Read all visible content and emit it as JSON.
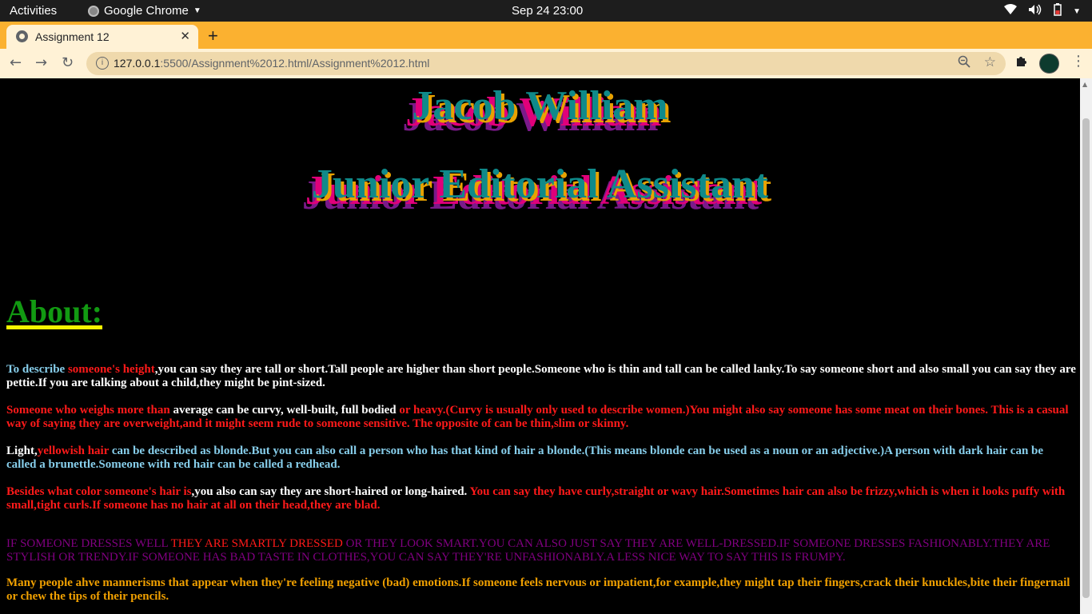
{
  "system_bar": {
    "activities": "Activities",
    "app_name": "Google Chrome",
    "clock": "Sep 24  23:00"
  },
  "browser": {
    "tab_title": "Assignment 12",
    "new_tab": "+",
    "url_host": "127.0.0.1",
    "url_rest": ":5500/Assignment%2012.html/Assignment%2012.html"
  },
  "page": {
    "name": "Jacob William",
    "role": "Junior Editorial Assistant",
    "about_heading": "About:",
    "p1": {
      "a": "To describe ",
      "b": "someone's height",
      "c": ",you can say they are tall or short.Tall people are higher than short people.Someone who is thin and tall can be called lanky.To say someone short and also small you can say they are pettie.If you are talking about a child,they might be pint-sized."
    },
    "p2": {
      "a": "Someone who weighs more than ",
      "b": "average can be curvy, well-built, full bodied",
      "c": " or heavy.(Curvy is usually only used to describe women.)You might also say someone has some meat on their bones. This is a casual way of saying they are overweight,and it might seem rude to someone sensitive. The opposite of can be thin,slim or skinny."
    },
    "p3": {
      "a": "Light,",
      "b": "yellowish hair",
      "c": " can be described as blonde.But you can also call a person who has that kind of hair a blonde.(This means blonde can be used as a noun or an adjective.)A person with dark hair can be called a brunettle.Someone with red hair can be called a redhead."
    },
    "p4": {
      "a": "Besides what color someone's hair is",
      "b": ",you also can say they are short-haired or long-haired.",
      "c": " You can say they have curly,straight or wavy hair.Sometimes hair can also be frizzy,which is when it looks puffy with small,tight curls.If someone has no hair at all on their head,they are blad."
    },
    "p5": {
      "a": "IF SOMEONE DRESSES WELL ",
      "b": "THEY ARE SMARTLY DRESSED",
      "c": " OR THEY LOOK SMART.YOU CAN ALSO JUST SAY THEY ARE WELL-DRESSED.IF SOMEONE DRESSES FASHIONABLY.THEY ARE STYLISH OR TRENDY.IF SOMEONE HAS BAD TASTE IN CLOTHES,YOU CAN SAY THEY'RE UNFASHIONABLY.A LESS NICE WAY TO SAY THIS IS FRUMPY."
    },
    "p6": "Many people ahve mannerisms that appear when they're feeling negative (bad) emotions.If someone feels nervous or impatient,for example,they might tap their fingers,crack their knuckles,bite their fingernail or chew the tips of their pencils."
  },
  "colors": {
    "tab_strip": "#fbb130",
    "toolbar": "#fff2d6",
    "heading_fill": "#0f8a8a",
    "about": "#129a12",
    "underline": "#f5f500"
  },
  "icons": [
    "chrome-icon",
    "globe-favicon-icon",
    "close-icon",
    "back-arrow-icon",
    "forward-arrow-icon",
    "reload-icon",
    "info-icon",
    "zoom-icon",
    "star-icon",
    "extensions-icon",
    "profile-avatar",
    "kebab-menu-icon",
    "wifi-icon",
    "volume-icon",
    "battery-icon",
    "power-caret-icon"
  ]
}
